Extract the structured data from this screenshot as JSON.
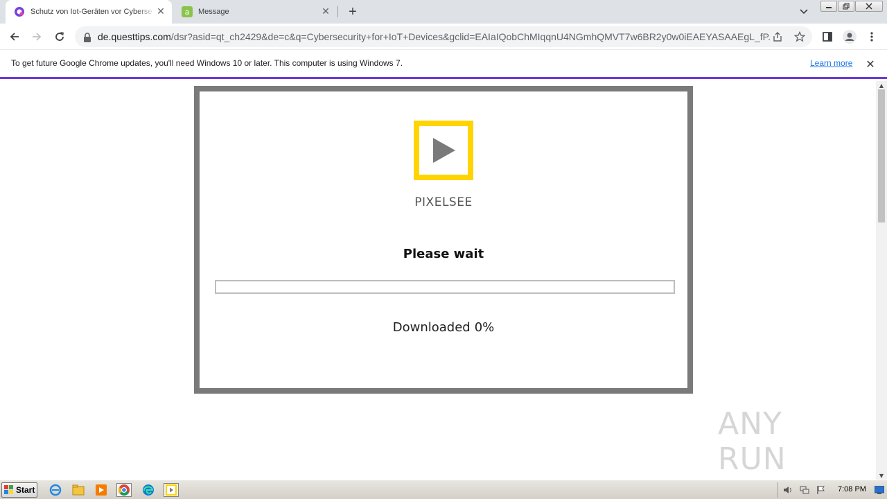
{
  "browser": {
    "tabs": [
      {
        "title": "Schutz von Iot-Geräten vor Cyberse",
        "active": true
      },
      {
        "title": "Message",
        "active": false
      }
    ],
    "new_tab_label": "+",
    "close_glyph": "✕",
    "window_controls": [
      "minimize-icon",
      "restore-icon",
      "close-icon"
    ]
  },
  "toolbar": {
    "url_host": "de.questtips.com",
    "url_rest": "/dsr?asid=qt_ch2429&de=c&q=Cybersecurity+for+IoT+Devices&gclid=EAIaIQobChMIqqnU4NGmhQMVT7w6BR2y0w0iEAEYASAAEgL_fP...",
    "icons": [
      "back-icon",
      "forward-icon",
      "reload-icon",
      "lock-icon",
      "share-icon",
      "star-icon",
      "side-panel-icon",
      "profile-icon",
      "menu-icon"
    ]
  },
  "infobar": {
    "message": "To get future Google Chrome updates, you'll need Windows 10 or later. This computer is using Windows 7.",
    "link": "Learn more",
    "close_glyph": "✕"
  },
  "page": {
    "brand": "PIXELSEE",
    "status_title": "Please wait",
    "progress_percent": 0,
    "downloaded_label": "Downloaded",
    "downloaded_value": "0%",
    "colors": {
      "logo_border": "#ffd400",
      "dialog_border": "#7a7a7a",
      "accent": "#6b3cd6"
    }
  },
  "watermark": "ANY RUN",
  "taskbar": {
    "start_label": "Start",
    "icons": [
      "ie-icon",
      "explorer-icon",
      "media-player-icon",
      "chrome-icon",
      "edge-icon",
      "pixelsee-icon"
    ],
    "clock": "7:08 PM"
  }
}
